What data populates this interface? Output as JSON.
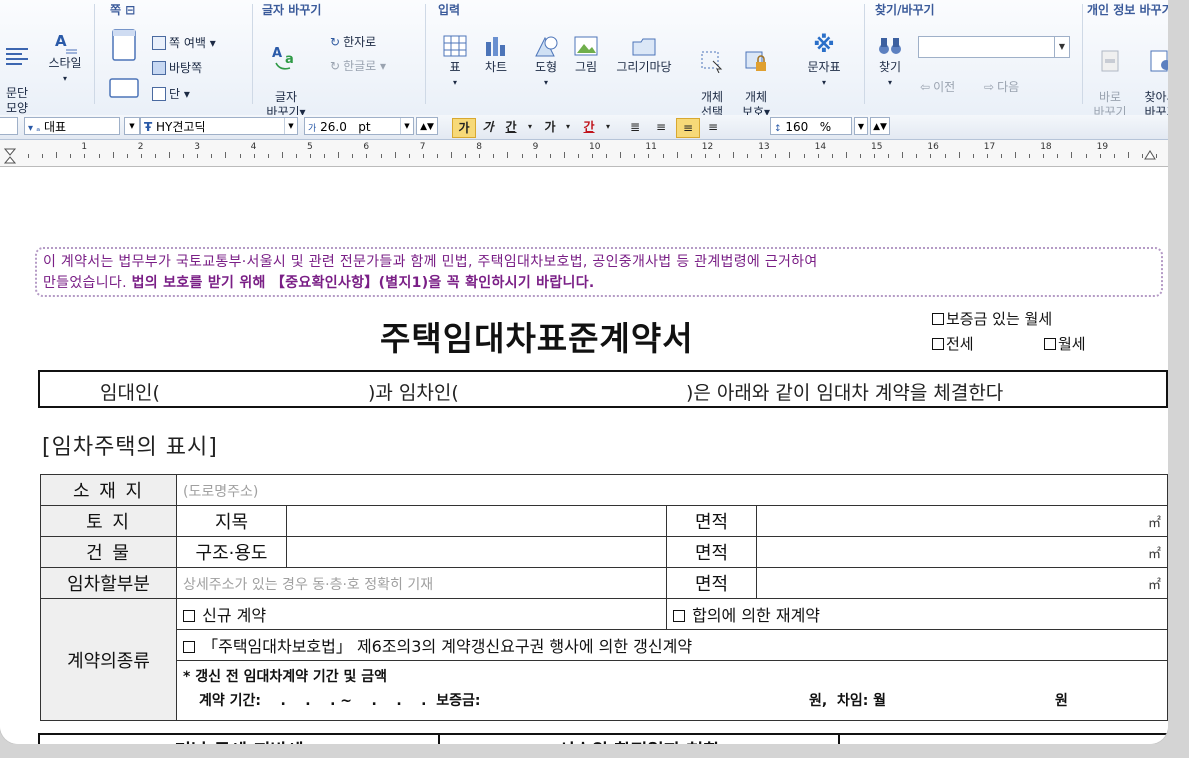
{
  "ribbon": {
    "groups": {
      "page": "쪽 ⊟",
      "replace": "글자 바꾸기",
      "input": "입력",
      "find": "찾기/바꾸기",
      "privacy": "개인 정보 바꾸기"
    },
    "para_shape": "문단\n모양",
    "style": "스타일",
    "page_margin": "쪽 여백 ▾",
    "page_bg": "바탕쪽",
    "column": "단 ▾",
    "char_replace": "글자\n바꾸기▾",
    "to_hanja": "한자로",
    "to_hangul": "한글로 ▾",
    "table": "표",
    "chart": "차트",
    "shape": "도형",
    "picture": "그림",
    "drawing": "그리기마당",
    "obj_select": "개체\n선택",
    "obj_protect": "개체\n보호▾",
    "char_map": "문자표",
    "find": "찾기",
    "prev": "이전",
    "next": "다음",
    "quick_replace": "바로\n바꾸기",
    "find_replace": "찾아서\n바꾸기"
  },
  "format_bar": {
    "style_value": "대표",
    "font_value": "HY견고딕",
    "size_value": "26.0",
    "size_unit": "pt",
    "bold": "가",
    "italic": "가",
    "underline": "간",
    "strike": "가",
    "color": "간",
    "line_spacing": "160",
    "line_unit": "%"
  },
  "ruler": {
    "numbers": [
      "1",
      "2",
      "3",
      "4",
      "5",
      "6",
      "7",
      "8",
      "9",
      "10",
      "11",
      "12",
      "13",
      "14",
      "15",
      "16",
      "17",
      "18",
      "19"
    ]
  },
  "document": {
    "notice_line1": "이 계약서는 법무부가 국토교통부·서울시 및 관련 전문가들과 함께 민법, 주택임대차보호법, 공인중개사법 등 관계법령에 근거하여",
    "notice_line2_plain": "만들었습니다. ",
    "notice_line2_bold": "법의 보호를 받기 위해 【중요확인사항】(별지1)을 꼭 확인하시기 바랍니다.",
    "title": "주택임대차표준계약서",
    "opt_deposit_monthly": "보증금 있는 월세",
    "opt_jeonse": "전세",
    "opt_monthly": "월세",
    "party_1": "임대인(",
    "party_2": ")과 임차인(",
    "party_3": ")은 아래와 같이 임대차 계약을 체결한다",
    "section_title": "[임차주택의 표시]",
    "rows": {
      "location_label": "소 재 지",
      "location_hint": "(도로명주소)",
      "land_label": "토    지",
      "land_type": "지목",
      "area": "면적",
      "building_label": "건    물",
      "building_type": "구조·용도",
      "part_label": "임차할부분",
      "part_hint": "상세주소가 있는 경우 동·층·호 정확히 기재",
      "unit": "㎡",
      "contract_kind_label": "계약의종류",
      "new_contract": "신규 계약",
      "re_contract": "합의에 의한 재계약",
      "renewal": "「주택임대차보호법」 제6조의3의 계약갱신요구권 행사에 의한 갱신계약",
      "prior_terms": "* 갱신 전 임대차계약 기간 및 금액",
      "period_line_a": "계약 기간:    .    .    . ~    .    .    .  보증금:",
      "period_line_b": "원,  차임: 월",
      "period_line_c": "원"
    },
    "bottom_left": "미납 국세·지방세",
    "bottom_mid": "선순위 확정일자 현황"
  }
}
